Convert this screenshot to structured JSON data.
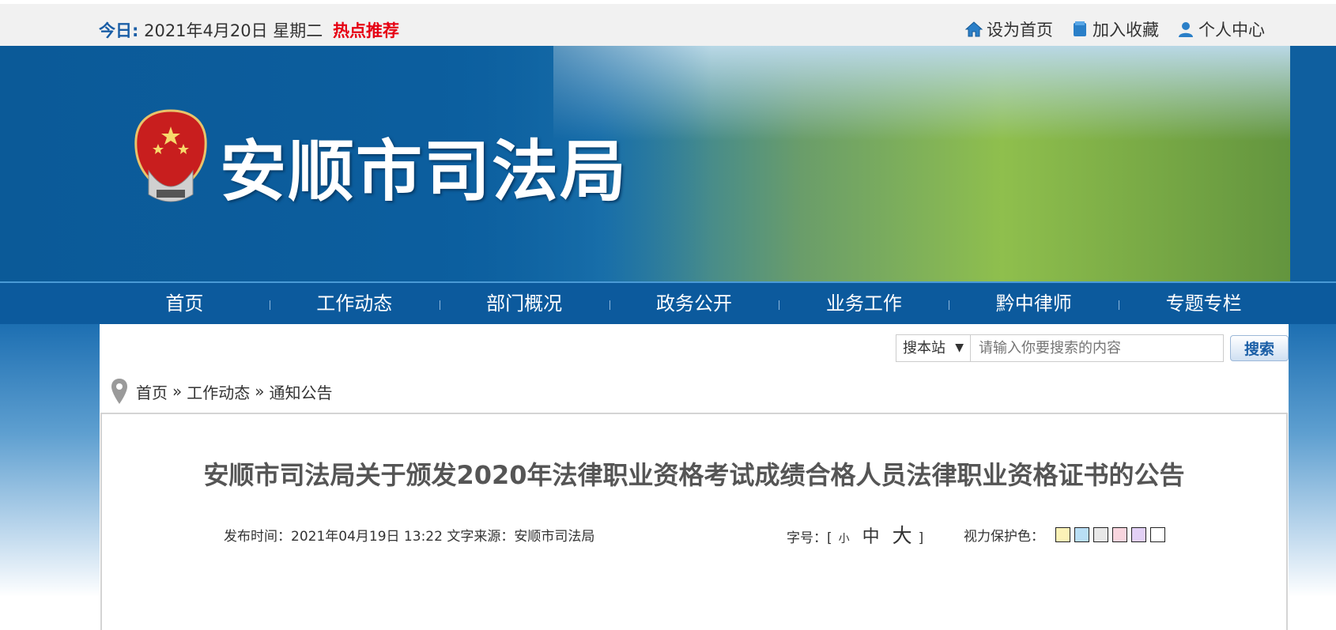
{
  "topbar": {
    "today_label": "今日:",
    "date": "2021年4月20日 星期二",
    "hot": "热点推荐",
    "links": {
      "home": "设为首页",
      "favorite": "加入收藏",
      "personal": "个人中心"
    }
  },
  "banner": {
    "site_title": "安顺市司法局",
    "emblem": "judicial-emblem"
  },
  "nav": [
    "首页",
    "工作动态",
    "部门概况",
    "政务公开",
    "业务工作",
    "黔中律师",
    "专题专栏"
  ],
  "search": {
    "scope": "搜本站",
    "placeholder": "请输入你要搜索的内容",
    "button": "搜索"
  },
  "breadcrumb": [
    "首页",
    "工作动态",
    "通知公告"
  ],
  "breadcrumb_sep": "»",
  "article": {
    "title": "安顺市司法局关于颁发2020年法律职业资格考试成绩合格人员法律职业资格证书的公告",
    "meta": "发布时间：2021年04月19日 13:22 文字来源：安顺市司法局",
    "fontsize_label": "字号：",
    "fontsize": {
      "open": "[",
      "small": "小",
      "medium": "中",
      "large": "大",
      "close": "]"
    },
    "eyecare_label": "视力保护色：",
    "swatches": [
      "#fbf2b7",
      "#b9def5",
      "#e8e8e8",
      "#f8d5de",
      "#e2d0f5",
      "#ffffff"
    ]
  },
  "colors": {
    "primary_blue": "#0c5a9d",
    "hot_red": "#e60012"
  }
}
